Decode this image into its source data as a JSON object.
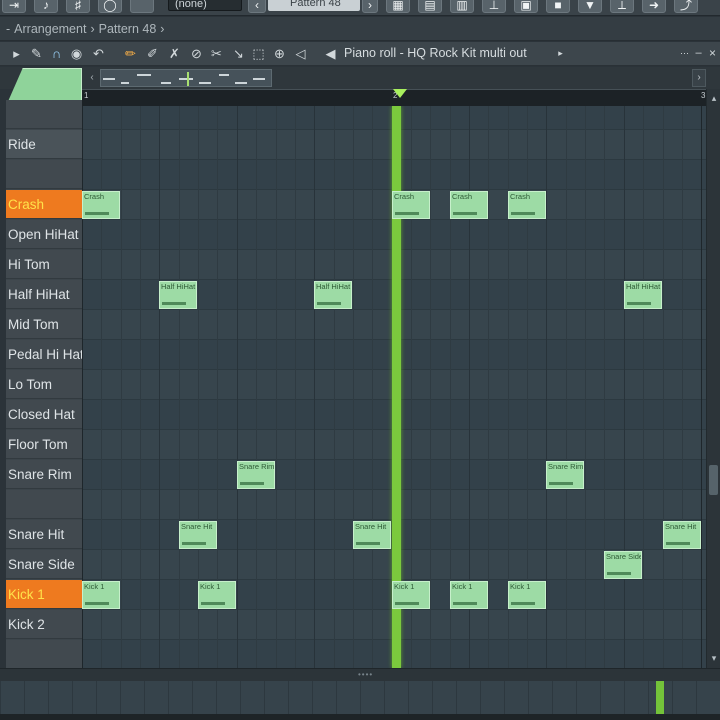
{
  "top_toolbar": {
    "buttons": [
      "⇥",
      "♪",
      "♯",
      "◯"
    ],
    "preset_select": "(none)",
    "pattern_select": "Pattern 48"
  },
  "breadcrumb": {
    "items": [
      "Arrangement",
      "Pattern 48"
    ]
  },
  "piano_roll": {
    "title": "Piano roll - HQ Rock Kit multi out",
    "tools": [
      "arrow-icon",
      "wrench-icon",
      "magnet-icon",
      "record-icon",
      "undo-icon",
      "pencil-icon",
      "paint-icon",
      "delete-icon",
      "mute-icon",
      "slice-icon",
      "select-icon",
      "zoom-icon",
      "speaker-icon",
      "playback-icon"
    ]
  },
  "ruler": {
    "bars": [
      "1",
      "2",
      "3"
    ]
  },
  "keys": [
    {
      "label": "",
      "state": "normal"
    },
    {
      "label": "Ride",
      "state": "alt"
    },
    {
      "label": "",
      "state": "normal"
    },
    {
      "label": "Crash",
      "state": "active"
    },
    {
      "label": "Open HiHat",
      "state": "normal"
    },
    {
      "label": "Hi Tom",
      "state": "normal"
    },
    {
      "label": "Half HiHat",
      "state": "normal"
    },
    {
      "label": "Mid Tom",
      "state": "normal"
    },
    {
      "label": "Pedal Hi Hat",
      "state": "normal"
    },
    {
      "label": "Lo Tom",
      "state": "normal"
    },
    {
      "label": "Closed Hat",
      "state": "normal"
    },
    {
      "label": "Floor Tom",
      "state": "normal"
    },
    {
      "label": "Snare Rim",
      "state": "normal"
    },
    {
      "label": "",
      "state": "normal"
    },
    {
      "label": "Snare Hit",
      "state": "normal"
    },
    {
      "label": "Snare Side",
      "state": "normal"
    },
    {
      "label": "Kick 1",
      "state": "active"
    },
    {
      "label": "Kick 2",
      "state": "normal"
    },
    {
      "label": "",
      "state": "normal"
    }
  ],
  "notes": [
    {
      "label": "Crash",
      "row": 3,
      "step": 0
    },
    {
      "label": "Crash",
      "row": 3,
      "step": 16
    },
    {
      "label": "Crash",
      "row": 3,
      "step": 19
    },
    {
      "label": "Crash",
      "row": 3,
      "step": 22
    },
    {
      "label": "Half HiHat",
      "row": 6,
      "step": 4
    },
    {
      "label": "Half HiHat",
      "row": 6,
      "step": 12
    },
    {
      "label": "Half HiHat",
      "row": 6,
      "step": 28
    },
    {
      "label": "Snare Rim",
      "row": 12,
      "step": 8
    },
    {
      "label": "Snare Rim",
      "row": 12,
      "step": 24
    },
    {
      "label": "Snare Hit",
      "row": 14,
      "step": 5
    },
    {
      "label": "Snare Hit",
      "row": 14,
      "step": 14
    },
    {
      "label": "Snare Hit",
      "row": 14,
      "step": 30
    },
    {
      "label": "Snare Side",
      "row": 15,
      "step": 27
    },
    {
      "label": "Kick 1",
      "row": 16,
      "step": 0
    },
    {
      "label": "Kick 1",
      "row": 16,
      "step": 6
    },
    {
      "label": "Kick 1",
      "row": 16,
      "step": 16
    },
    {
      "label": "Kick 1",
      "row": 16,
      "step": 19
    },
    {
      "label": "Kick 1",
      "row": 16,
      "step": 22
    }
  ],
  "playhead_step": 16,
  "colors": {
    "note_fill": "#9ddba5",
    "active_key": "#ee7a1f",
    "active_key_text": "#ffe24a",
    "playhead": "#7bc93d"
  }
}
